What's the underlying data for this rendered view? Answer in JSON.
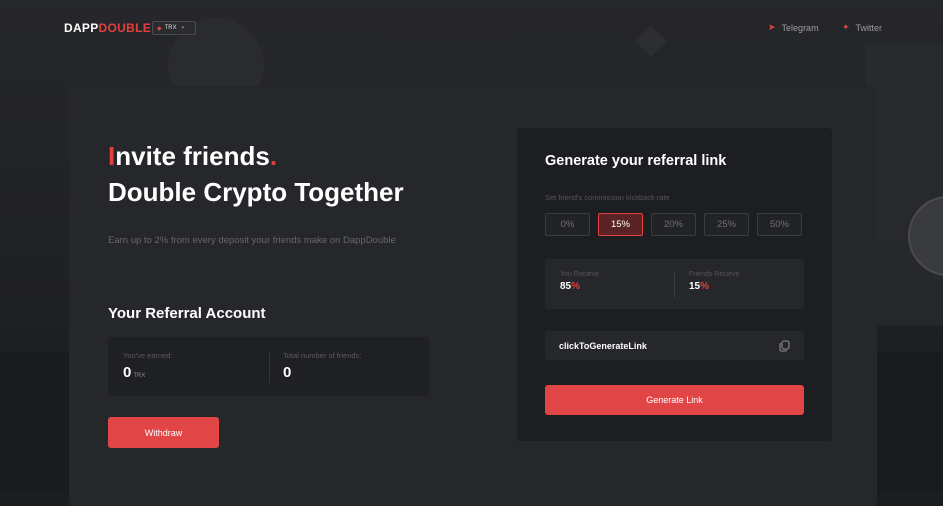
{
  "header": {
    "logo_white": "DAPP",
    "logo_red": "DOUBLE",
    "currency": "TRX",
    "links": [
      {
        "label": "Telegram",
        "icon": "telegram-icon"
      },
      {
        "label": "Twitter",
        "icon": "twitter-icon"
      }
    ]
  },
  "hero": {
    "title_first_letter": "I",
    "title_rest": "nvite friends",
    "title_dot": ".",
    "title_line2": "Double Crypto Together",
    "subtitle": "Earn up to 2% from every deposit your friends make on DappDouble"
  },
  "account": {
    "title": "Your Referral Account",
    "earned_label": "You've earned:",
    "earned_value": "0",
    "earned_unit": "TRX",
    "friends_label": "Total number of friends:",
    "friends_value": "0",
    "withdraw_label": "Withdraw"
  },
  "generator": {
    "title": "Generate your referral link",
    "rate_label": "Set friend's commission kickback rate",
    "rates": [
      "0%",
      "15%",
      "20%",
      "25%",
      "50%"
    ],
    "selected_rate": "15%",
    "you_receive_label": "You Recieve",
    "you_receive_num": "85",
    "friends_receive_label": "Friends Recieve",
    "friends_receive_num": "15",
    "percent_sign": "%",
    "link_placeholder": "clickToGenerateLink",
    "generate_label": "Generate Link"
  },
  "colors": {
    "accent": "#e2403f",
    "background": "#1c1d20",
    "card": "#26272b"
  }
}
